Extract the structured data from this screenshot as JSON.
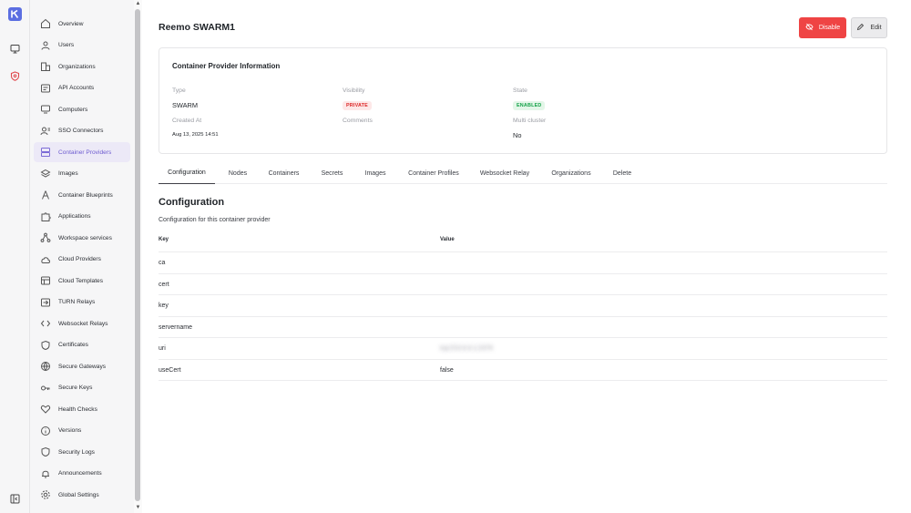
{
  "rail": {
    "logo": "kasm-logo-icon",
    "items": [
      {
        "icon": "monitor-icon"
      },
      {
        "icon": "shield-admin-icon",
        "accent": "#e0474c"
      }
    ],
    "bottom": {
      "icon": "collapse-sidebar-icon"
    }
  },
  "sidebar": {
    "items": [
      {
        "label": "Overview",
        "icon": "home-icon"
      },
      {
        "label": "Users",
        "icon": "user-icon"
      },
      {
        "label": "Organizations",
        "icon": "building-icon"
      },
      {
        "label": "API Accounts",
        "icon": "api-icon"
      },
      {
        "label": "Computers",
        "icon": "computer-icon"
      },
      {
        "label": "SSO Connectors",
        "icon": "sso-icon"
      },
      {
        "label": "Container Providers",
        "icon": "server-icon",
        "active": true
      },
      {
        "label": "Images",
        "icon": "layers-icon"
      },
      {
        "label": "Container Blueprints",
        "icon": "compass-icon"
      },
      {
        "label": "Applications",
        "icon": "puzzle-icon"
      },
      {
        "label": "Workspace services",
        "icon": "network-icon"
      },
      {
        "label": "Cloud Providers",
        "icon": "cloud-icon"
      },
      {
        "label": "Cloud Templates",
        "icon": "template-icon"
      },
      {
        "label": "TURN Relays",
        "icon": "relay-icon"
      },
      {
        "label": "Websocket Relays",
        "icon": "code-icon"
      },
      {
        "label": "Certificates",
        "icon": "certificate-icon"
      },
      {
        "label": "Secure Gateways",
        "icon": "globe-icon"
      },
      {
        "label": "Secure Keys",
        "icon": "key-icon"
      },
      {
        "label": "Health Checks",
        "icon": "heart-icon"
      },
      {
        "label": "Versions",
        "icon": "info-icon"
      },
      {
        "label": "Security Logs",
        "icon": "shield-icon"
      },
      {
        "label": "Announcements",
        "icon": "bell-icon"
      },
      {
        "label": "Global Settings",
        "icon": "gear-icon"
      }
    ]
  },
  "header": {
    "title": "Reemo SWARM1",
    "disable_label": "Disable",
    "edit_label": "Edit"
  },
  "info_card": {
    "title": "Container Provider Information",
    "type_label": "Type",
    "type_value": "SWARM",
    "visibility_label": "Visibility",
    "visibility_value": "PRIVATE",
    "state_label": "State",
    "state_value": "ENABLED",
    "created_label": "Created At",
    "created_value": "Aug 13, 2025 14:51",
    "comments_label": "Comments",
    "multicluster_label": "Multi cluster",
    "multicluster_value": "No"
  },
  "tabs": [
    "Configuration",
    "Nodes",
    "Containers",
    "Secrets",
    "Images",
    "Container Profiles",
    "Websocket Relay",
    "Organizations",
    "Delete"
  ],
  "config": {
    "title": "Configuration",
    "subtitle": "Configuration for this container provider",
    "col_key": "Key",
    "col_value": "Value",
    "rows": [
      {
        "key": "ca",
        "value": ""
      },
      {
        "key": "cert",
        "value": ""
      },
      {
        "key": "key",
        "value": ""
      },
      {
        "key": "servername",
        "value": ""
      },
      {
        "key": "uri",
        "value": "tcp://10.0.0.1:2376",
        "blurred": true
      },
      {
        "key": "useCert",
        "value": "false"
      }
    ]
  },
  "colors": {
    "accent": "#6d5bd0",
    "danger": "#ef4444",
    "success": "#16a34a"
  }
}
